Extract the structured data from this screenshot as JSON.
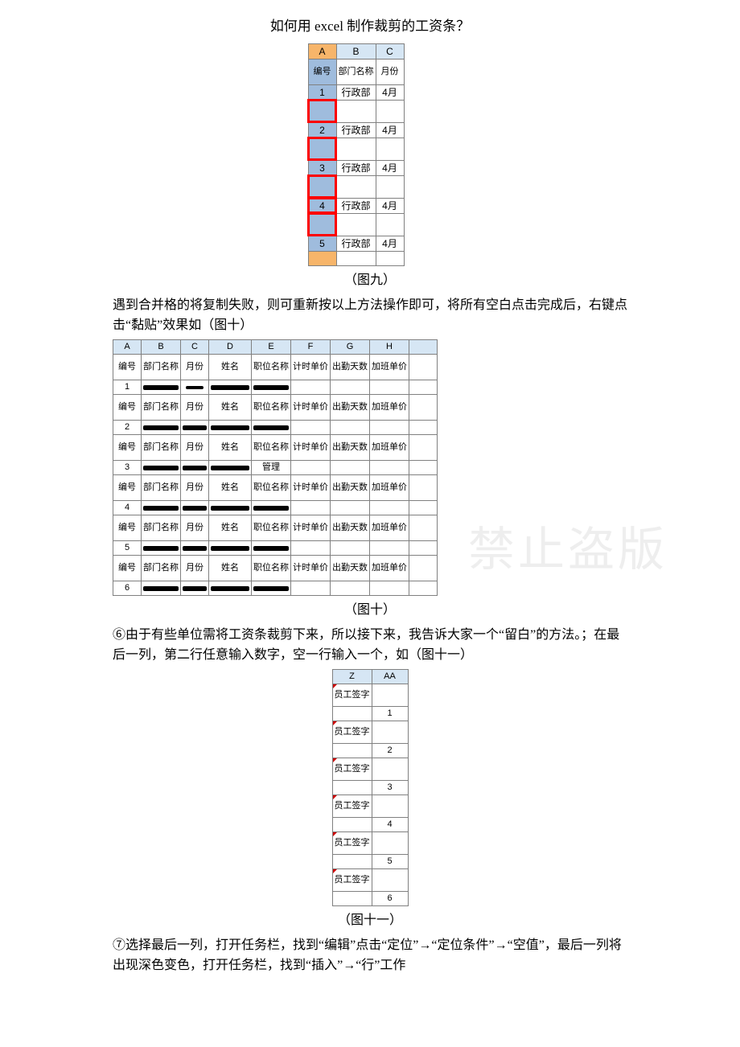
{
  "title": "如何用 excel 制作裁剪的工资条？",
  "captions": {
    "fig9": "（图九）",
    "fig10": "（图十）",
    "fig11": "（图十一）"
  },
  "paragraphs": {
    "p1": "遇到合并格的将复制失败，则可重新按以上方法操作即可，将所有空白点击完成后，右键点击“黏贴”效果如（图十）",
    "p2": "⑥由于有些单位需将工资条裁剪下来，所以接下来，我告诉大家一个“留白”的方法。；在最后一列，第二行任意输入数字，空一行输入一个，如（图十一）",
    "p3": "⑦选择最后一列，打开任务栏，找到“编辑”点击“定位”→“定位条件”→“空值”，最后一列将出现深色变色，打开任务栏，找到“插入”→“行”工作"
  },
  "fig9": {
    "cols": [
      "A",
      "B",
      "C"
    ],
    "hdr": {
      "a": "编号",
      "b": "部门名称",
      "c": "月份"
    },
    "rows": [
      {
        "a": "1",
        "b": "行政部",
        "c": "4月"
      },
      {
        "a": "2",
        "b": "行政部",
        "c": "4月"
      },
      {
        "a": "3",
        "b": "行政部",
        "c": "4月"
      },
      {
        "a": "4",
        "b": "行政部",
        "c": "4月"
      },
      {
        "a": "5",
        "b": "行政部",
        "c": "4月"
      }
    ]
  },
  "fig10": {
    "cols": [
      "A",
      "B",
      "C",
      "D",
      "E",
      "F",
      "G",
      "H"
    ],
    "hdr": {
      "a": "编号",
      "b": "部门名称",
      "c": "月份",
      "d": "姓名",
      "e": "职位名称",
      "f": "计时单价",
      "g": "出勤天数",
      "h": "加班单价"
    },
    "nums": [
      "1",
      "2",
      "3",
      "4",
      "5",
      "6"
    ],
    "mgmt": "管理"
  },
  "fig11": {
    "cols": [
      "Z",
      "AA"
    ],
    "label": "员工签字",
    "nums": [
      "1",
      "2",
      "3",
      "4",
      "5",
      "6"
    ]
  },
  "watermark": "禁止盗版"
}
